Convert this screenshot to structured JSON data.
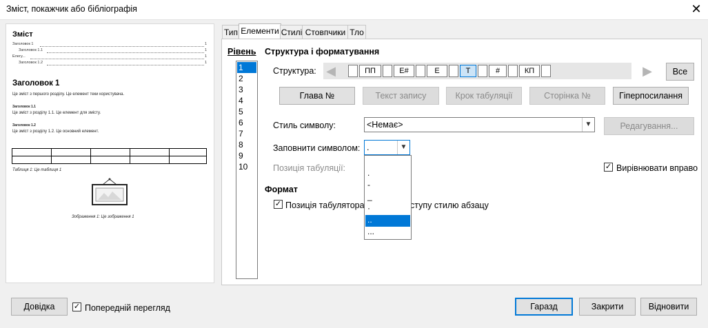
{
  "window": {
    "title": "Зміст, покажчик або бібліографія",
    "close_label": "✕"
  },
  "preview": {
    "toc_title": "Зміст",
    "toc_lines": [
      "Заголовок 1",
      "Заголовок 1.1",
      "Елегу...",
      "Заголовок 1.2"
    ],
    "toc_pages": [
      "1",
      "1",
      "1",
      "1"
    ],
    "heading": "Заголовок 1",
    "para1": "Це зміст з першого розділу. Це елемент теки користувача.",
    "sub1": "Заголовок 1.1",
    "para2": "Це зміст з розділу 1.1. Це елемент для змісту.",
    "sub2": "Заголовок 1.2",
    "para3": "Це зміст з розділу 1.2. Це основний елемент.",
    "table_caption": "Таблиця 1: Це таблиця 1",
    "image_caption": "Зображення 1: Це зображення 1"
  },
  "tabs": [
    "Тип",
    "Елементи",
    "Стилі",
    "Стовпчики",
    "Тло"
  ],
  "active_tab": "Елементи",
  "levels": {
    "label": "Рівень",
    "items": [
      "1",
      "2",
      "3",
      "4",
      "5",
      "6",
      "7",
      "8",
      "9",
      "10"
    ],
    "selected": "1"
  },
  "structure": {
    "section_title": "Структура і форматування",
    "label": "Структура:",
    "tokens": [
      "ПП",
      "Е#",
      "Е",
      "Т",
      "#",
      "КП"
    ],
    "selected_token": "Т",
    "all_button": "Все",
    "left_arrow": "◀",
    "right_arrow": "▶"
  },
  "insert_buttons": {
    "chapter": "Глава №",
    "entry_text": "Текст запису",
    "tab_stop": "Крок табуляції",
    "page_no": "Сторінка №",
    "hyperlink": "Гіперпосилання"
  },
  "char_style": {
    "label": "Стиль символу:",
    "value": "<Немає>",
    "edit_button": "Редагування..."
  },
  "fill_char": {
    "label": "Заповнити символом:",
    "value": ".",
    "options": [
      " ",
      ".",
      "-",
      "_",
      "·",
      "..",
      "..."
    ],
    "selected_index": 5
  },
  "tab_position": {
    "label": "Позиція табуляції:"
  },
  "align_right": {
    "label": "Вирівнювати вправо",
    "checked": true
  },
  "format": {
    "section_title": "Формат",
    "tab_relative_pre": "Позиція табулятора в",
    "tab_relative_post": "ступу стилю абзацу",
    "checked": true
  },
  "footer": {
    "help": "Довідка",
    "preview_label": "Попередній перегляд",
    "preview_checked": true,
    "ok": "Гаразд",
    "close": "Закрити",
    "reset": "Відновити"
  },
  "colors": {
    "accent": "#0078d7",
    "disabled_text": "#8a8a8a"
  }
}
